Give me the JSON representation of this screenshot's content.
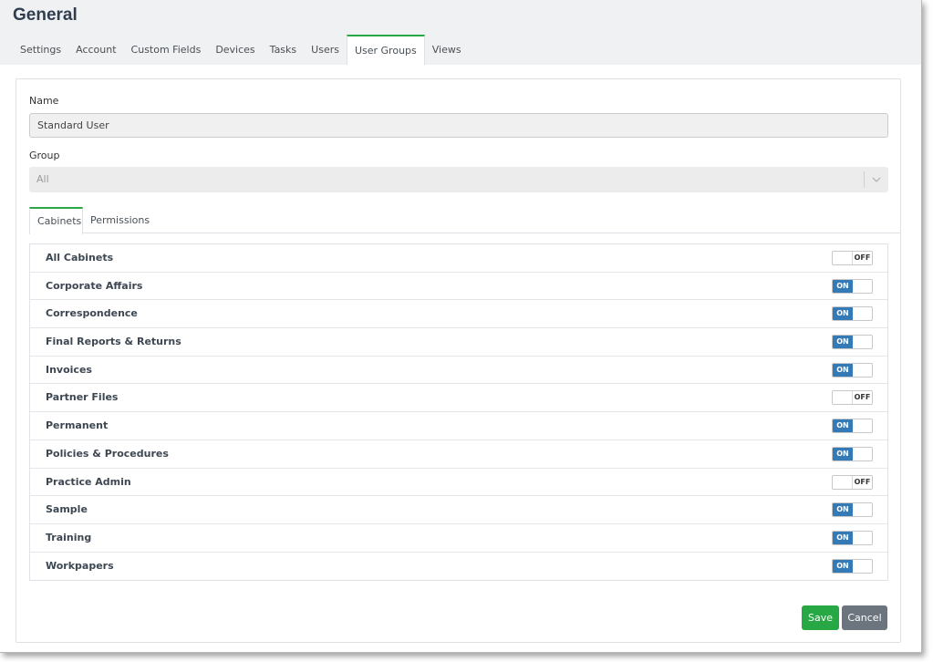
{
  "page": {
    "title": "General"
  },
  "main_tabs": [
    {
      "label": "Settings",
      "active": false
    },
    {
      "label": "Account",
      "active": false
    },
    {
      "label": "Custom Fields",
      "active": false
    },
    {
      "label": "Devices",
      "active": false
    },
    {
      "label": "Tasks",
      "active": false
    },
    {
      "label": "Users",
      "active": false
    },
    {
      "label": "User Groups",
      "active": true
    },
    {
      "label": "Views",
      "active": false
    }
  ],
  "form": {
    "name_label": "Name",
    "name_value": "Standard User",
    "group_label": "Group",
    "group_value": "All"
  },
  "sub_tabs": [
    {
      "label": "Cabinets",
      "active": true
    },
    {
      "label": "Permissions",
      "active": false
    }
  ],
  "cabinets": [
    {
      "label": "All Cabinets",
      "state": "OFF"
    },
    {
      "label": "Corporate Affairs",
      "state": "ON"
    },
    {
      "label": "Correspondence",
      "state": "ON"
    },
    {
      "label": "Final Reports & Returns",
      "state": "ON"
    },
    {
      "label": "Invoices",
      "state": "ON"
    },
    {
      "label": "Partner Files",
      "state": "OFF"
    },
    {
      "label": "Permanent",
      "state": "ON"
    },
    {
      "label": "Policies & Procedures",
      "state": "ON"
    },
    {
      "label": "Practice Admin",
      "state": "OFF"
    },
    {
      "label": "Sample",
      "state": "ON"
    },
    {
      "label": "Training",
      "state": "ON"
    },
    {
      "label": "Workpapers",
      "state": "ON"
    }
  ],
  "actions": {
    "save_label": "Save",
    "cancel_label": "Cancel"
  },
  "colors": {
    "accent_green": "#28a745",
    "toggle_on": "#337ab7",
    "cancel_gray": "#6c757d",
    "title": "#2f3d4e"
  },
  "icons": {
    "group_select_arrow": "chevron-down-icon"
  }
}
